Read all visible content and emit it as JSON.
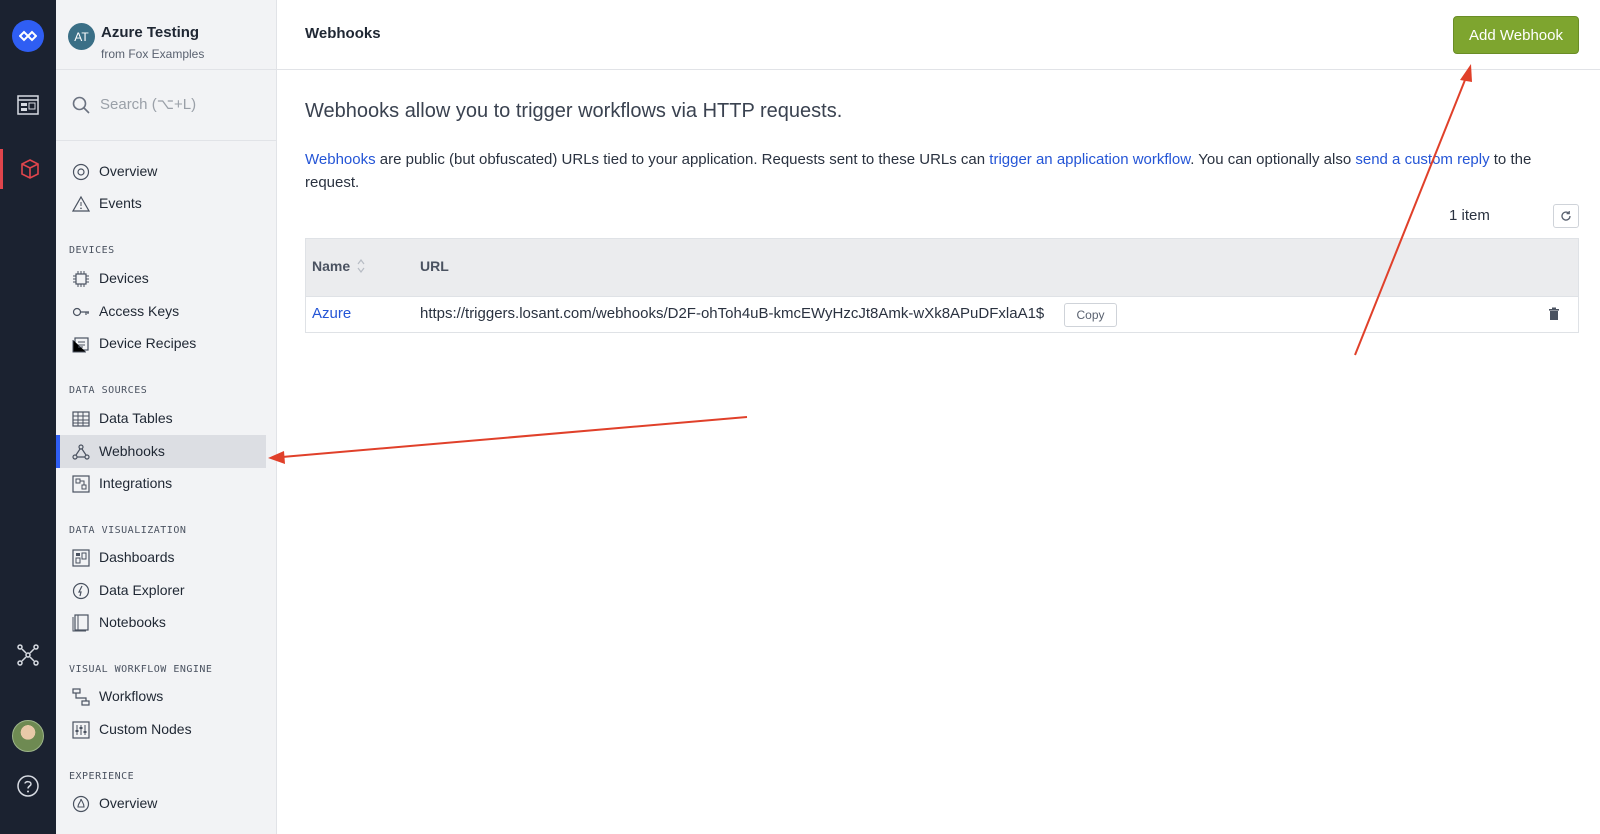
{
  "app": {
    "badge": "AT",
    "name": "Azure Testing",
    "subtitle": "from Fox Examples"
  },
  "search": {
    "placeholder": "Search (⌥+L)"
  },
  "nav": {
    "overview": "Overview",
    "events": "Events",
    "devices_section": "DEVICES",
    "devices": "Devices",
    "access_keys": "Access Keys",
    "device_recipes": "Device Recipes",
    "data_sources_section": "DATA SOURCES",
    "data_tables": "Data Tables",
    "webhooks": "Webhooks",
    "integrations": "Integrations",
    "data_viz_section": "DATA VISUALIZATION",
    "dashboards": "Dashboards",
    "data_explorer": "Data Explorer",
    "notebooks": "Notebooks",
    "vwe_section": "VISUAL WORKFLOW ENGINE",
    "workflows": "Workflows",
    "custom_nodes": "Custom Nodes",
    "experience_section": "EXPERIENCE",
    "exp_overview": "Overview"
  },
  "header": {
    "title": "Webhooks",
    "add_button": "Add Webhook"
  },
  "content": {
    "lead": "Webhooks allow you to trigger workflows via HTTP requests.",
    "desc_link1": "Webhooks",
    "desc_text1": " are public (but obfuscated) URLs tied to your application. Requests sent to these URLs can ",
    "desc_link2": "trigger an application workflow",
    "desc_text2": ". You can optionally also ",
    "desc_link3": "send a custom reply",
    "desc_text3": " to the request.",
    "item_count": "1 item"
  },
  "table": {
    "columns": {
      "name": "Name",
      "url": "URL"
    },
    "rows": [
      {
        "name": "Azure",
        "url": "https://triggers.losant.com/webhooks/D2F-ohToh4uB-kmcEWyHzcJt8Amk-wXk8APuDFxlaA1$",
        "copy_label": "Copy"
      }
    ]
  },
  "colors": {
    "accent": "#2f5ef3",
    "add_button": "#7ea52f",
    "link": "#2455d6",
    "annotation_arrow": "#e0402a"
  }
}
